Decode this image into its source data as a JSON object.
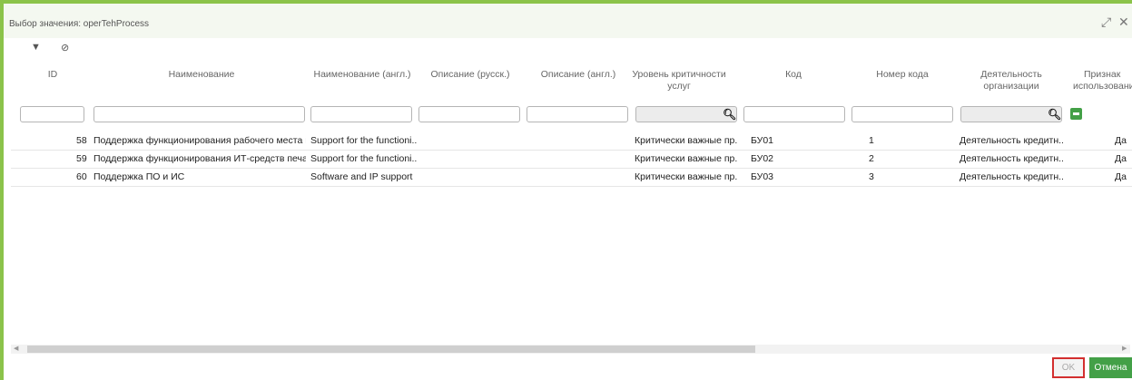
{
  "dialog": {
    "title": "Выбор значения: operTehProcess",
    "expand_icon": "expand-icon",
    "close_icon": "close-icon",
    "accent_color": "#8bc34a"
  },
  "toolbar": {
    "filter_icon": "filter-icon",
    "clear_filter_icon": "clear-filter-icon"
  },
  "table": {
    "headers": {
      "id": "ID",
      "name": "Наименование",
      "name_en": "Наименование (англ.)",
      "desc_ru": "Описание (русск.)",
      "desc_en": "Описание (англ.)",
      "crit_1": "Уровень критичности",
      "crit_2": "услуг",
      "code": "Код",
      "code_num": "Номер кода",
      "activity_1": "Деятельность",
      "activity_2": "организации",
      "sign_1": "Признак",
      "sign_2": "использования"
    },
    "rows": [
      {
        "id": "58",
        "name": "Поддержка функционирования рабочего места по...",
        "name_en": "Support for the functioni...",
        "desc_ru": "",
        "desc_en": "",
        "crit": "Критически важные пр...",
        "code": "БУ01",
        "code_num": "1",
        "activity": "Деятельность кредитн...",
        "sign": "Да"
      },
      {
        "id": "59",
        "name": "Поддержка функционирования ИТ-средств печат...",
        "name_en": "Support for the functioni...",
        "desc_ru": "",
        "desc_en": "",
        "crit": "Критически важные пр...",
        "code": "БУ02",
        "code_num": "2",
        "activity": "Деятельность кредитн...",
        "sign": "Да"
      },
      {
        "id": "60",
        "name": "Поддержка ПО и ИС",
        "name_en": "Software and IP support",
        "desc_ru": "",
        "desc_en": "",
        "crit": "Критически важные пр...",
        "code": "БУ03",
        "code_num": "3",
        "activity": "Деятельность кредитн...",
        "sign": "Да"
      }
    ]
  },
  "buttons": {
    "ok": "OK",
    "cancel": "Отмена",
    "cancel_color": "#43a047",
    "ok_highlight_color": "#d32f2f"
  }
}
